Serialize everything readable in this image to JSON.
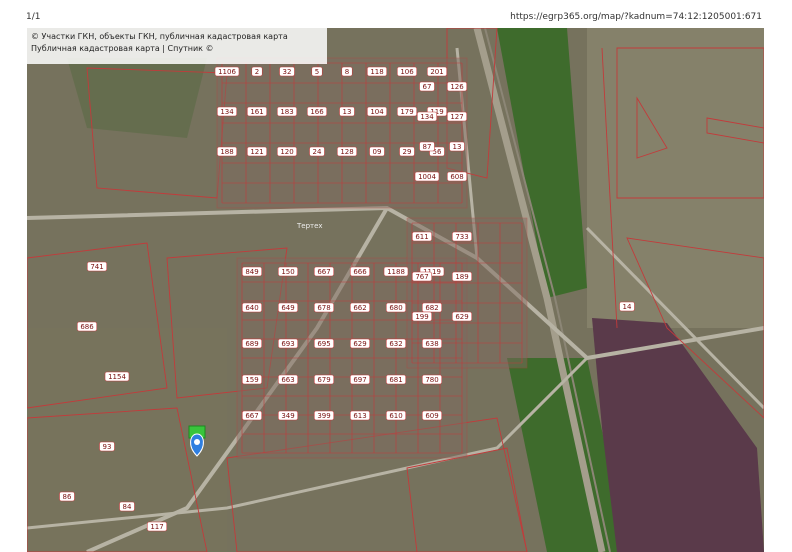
{
  "page": {
    "url": "https://egrp365.org/map/?kadnum=74:12:1205001:671",
    "page_num": "1/1"
  },
  "map": {
    "header_lines": [
      "© Участки ГКН, объекты ГКН, публичная кадастровая карта",
      "Публичная кадастровая карта | Спутник ©"
    ],
    "road_label": "Тертех",
    "colors": {
      "parcel": "#c23b3b",
      "vegetation": "#3e6b2c",
      "water": "#5a3a4a",
      "marker": "#2f7fe0",
      "highlight": "#39c43c"
    },
    "parcels": [
      {
        "n": "1106"
      },
      {
        "n": "2"
      },
      {
        "n": "32"
      },
      {
        "n": "5"
      },
      {
        "n": "8"
      },
      {
        "n": "118"
      },
      {
        "n": "106"
      },
      {
        "n": "201"
      },
      {
        "n": "134"
      },
      {
        "n": "161"
      },
      {
        "n": "183"
      },
      {
        "n": "166"
      },
      {
        "n": "13"
      },
      {
        "n": "104"
      },
      {
        "n": "179"
      },
      {
        "n": "119"
      },
      {
        "n": "188"
      },
      {
        "n": "121"
      },
      {
        "n": "120"
      },
      {
        "n": "24"
      },
      {
        "n": "128"
      },
      {
        "n": "09"
      },
      {
        "n": "29"
      },
      {
        "n": "56"
      },
      {
        "n": "67"
      },
      {
        "n": "126"
      },
      {
        "n": "134"
      },
      {
        "n": "127"
      },
      {
        "n": "87"
      },
      {
        "n": "13"
      },
      {
        "n": "1004"
      },
      {
        "n": "608"
      },
      {
        "n": "849"
      },
      {
        "n": "150"
      },
      {
        "n": "667"
      },
      {
        "n": "666"
      },
      {
        "n": "1188"
      },
      {
        "n": "1119"
      },
      {
        "n": "640"
      },
      {
        "n": "649"
      },
      {
        "n": "678"
      },
      {
        "n": "662"
      },
      {
        "n": "680"
      },
      {
        "n": "682"
      },
      {
        "n": "689"
      },
      {
        "n": "693"
      },
      {
        "n": "695"
      },
      {
        "n": "629"
      },
      {
        "n": "632"
      },
      {
        "n": "638"
      },
      {
        "n": "159"
      },
      {
        "n": "663"
      },
      {
        "n": "679"
      },
      {
        "n": "697"
      },
      {
        "n": "681"
      },
      {
        "n": "780"
      },
      {
        "n": "667"
      },
      {
        "n": "349"
      },
      {
        "n": "399"
      },
      {
        "n": "613"
      },
      {
        "n": "610"
      },
      {
        "n": "609"
      },
      {
        "n": "611"
      },
      {
        "n": "733"
      },
      {
        "n": "767"
      },
      {
        "n": "189"
      },
      {
        "n": "199"
      },
      {
        "n": "629"
      },
      {
        "n": "741"
      },
      {
        "n": "686"
      },
      {
        "n": "1154"
      },
      {
        "n": "93"
      },
      {
        "n": "86"
      },
      {
        "n": "84"
      },
      {
        "n": "117"
      },
      {
        "n": "14"
      }
    ]
  }
}
